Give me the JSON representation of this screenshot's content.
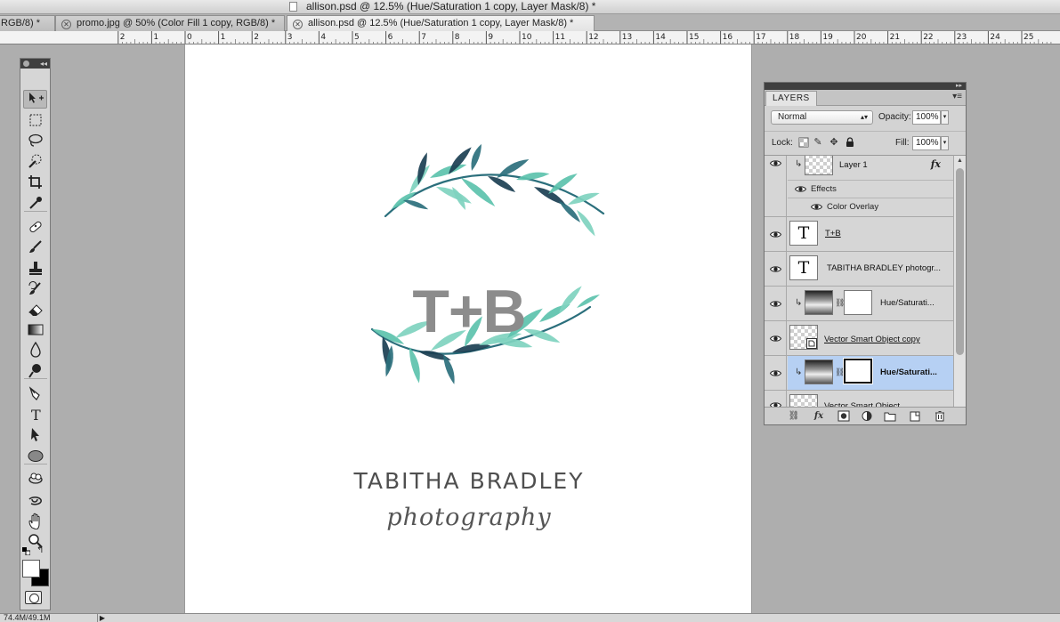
{
  "window": {
    "title": "allison.psd @ 12.5% (Hue/Saturation 1 copy, Layer Mask/8) *"
  },
  "tabs": [
    {
      "label": "RGB/8) *"
    },
    {
      "label": "promo.jpg @ 50% (Color Fill 1 copy, RGB/8) *"
    },
    {
      "label": "allison.psd @ 12.5% (Hue/Saturation 1 copy, Layer Mask/8) *"
    }
  ],
  "ruler": {
    "labels": [
      "2",
      "1",
      "0",
      "1",
      "2",
      "3",
      "4",
      "5",
      "6",
      "7",
      "8",
      "9",
      "10",
      "11",
      "12",
      "13",
      "14",
      "15",
      "16",
      "17",
      "18",
      "19",
      "20",
      "21",
      "22",
      "23",
      "24",
      "25"
    ]
  },
  "artwork": {
    "monogram": "T+B",
    "name": "TABITHA BRADLEY",
    "subtitle": "photography",
    "leaf_colors": [
      "#7fd3bf",
      "#5cc2ad",
      "#2b6f7c",
      "#1b3f52"
    ]
  },
  "toolbox": {
    "tools": [
      {
        "icon": "move-tool-icon",
        "selected": true
      },
      {
        "icon": "marquee-tool-icon"
      },
      {
        "icon": "lasso-tool-icon"
      },
      {
        "icon": "quick-selection-tool-icon"
      },
      {
        "icon": "crop-tool-icon"
      },
      {
        "icon": "eyedropper-tool-icon"
      },
      {
        "icon": "healing-brush-tool-icon"
      },
      {
        "icon": "brush-tool-icon"
      },
      {
        "icon": "clone-stamp-tool-icon"
      },
      {
        "icon": "history-brush-tool-icon"
      },
      {
        "icon": "eraser-tool-icon"
      },
      {
        "icon": "gradient-tool-icon"
      },
      {
        "icon": "blur-tool-icon"
      },
      {
        "icon": "dodge-tool-icon"
      },
      {
        "icon": "pen-tool-icon"
      },
      {
        "icon": "type-tool-icon"
      },
      {
        "icon": "path-selection-tool-icon"
      },
      {
        "icon": "ellipse-tool-icon"
      },
      {
        "icon": "3d-rotate-tool-icon"
      },
      {
        "icon": "3d-orbit-tool-icon"
      },
      {
        "icon": "hand-tool-icon"
      },
      {
        "icon": "zoom-tool-icon"
      }
    ],
    "foreground_color": "#ffffff",
    "background_color": "#000000"
  },
  "layers_panel": {
    "tab_label": "LAYERS",
    "blend_mode": "Normal",
    "opacity_label": "Opacity:",
    "opacity_value": "100%",
    "lock_label": "Lock:",
    "fill_label": "Fill:",
    "fill_value": "100%",
    "layers": [
      {
        "name": "Layer 1",
        "kind": "pixel",
        "clipped": true,
        "fx": true,
        "fx_label": "fx",
        "effects_label": "Effects",
        "effects": [
          "Color Overlay"
        ]
      },
      {
        "name": "T+B",
        "kind": "type",
        "thumb_label": "T"
      },
      {
        "name": "TABITHA BRADLEY photogr...",
        "kind": "type",
        "thumb_label": "T"
      },
      {
        "name": "Hue/Saturati...",
        "kind": "adjustment",
        "clipped": true
      },
      {
        "name": "Vector Smart Object copy",
        "kind": "smart"
      },
      {
        "name": "Hue/Saturati...",
        "kind": "adjustment",
        "clipped": true,
        "selected": true
      },
      {
        "name": "Vector Smart Object",
        "kind": "smart"
      }
    ],
    "selected_color": "#b6d0f3"
  },
  "status": {
    "doc_size": "74.4M/49.1M"
  }
}
